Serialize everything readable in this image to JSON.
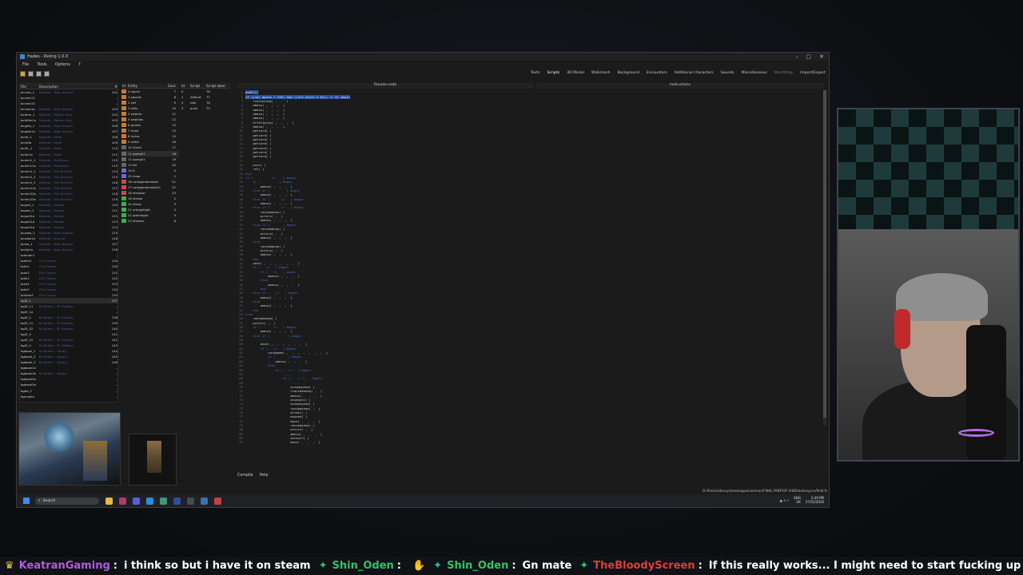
{
  "window": {
    "title": "Hades - Deling 1.0.0",
    "controls": [
      "–",
      "▢",
      "✕"
    ]
  },
  "menu": [
    "File",
    "Tools",
    "Options",
    "?"
  ],
  "tabs": [
    "Texts",
    "Scripts",
    "3D Model",
    "Walkmesh",
    "Background",
    "Encounters",
    "Additional characters",
    "Sounds",
    "Miscellaneous",
    "Worldmap",
    "Import/Export"
  ],
  "active_tab": "Scripts",
  "file_list": {
    "headers": [
      "File",
      "Description",
      "#"
    ],
    "rows": [
      [
        "bccent_1",
        "Balamb - Town Square",
        "102"
      ],
      [
        "bccent12",
        "",
        "–"
      ],
      [
        "bccent13",
        "",
        "–"
      ],
      [
        "bccent1a",
        "Balamb - Town Square",
        "103"
      ],
      [
        "bcform_1",
        "Balamb - Station Yard",
        "104"
      ],
      [
        "bchtlfm1a",
        "Balamb - Station Yard",
        "105"
      ],
      [
        "bcgate_1",
        "Balamb - Town Square",
        "106"
      ],
      [
        "bcgate1a",
        "Balamb - Town Square",
        "107"
      ],
      [
        "bchtl_1",
        "Balamb - Hotel",
        "108"
      ],
      [
        "bchtlfa",
        "Balamb - Hotel",
        "109"
      ],
      [
        "bchtr_1",
        "Balamb - Hotel",
        "110"
      ],
      [
        "bchtr1a",
        "Balamb - Hotel",
        "111"
      ],
      [
        "bcmin1_1",
        "Balamb - Residence",
        "112"
      ],
      [
        "bcmin11a",
        "Balamb - Residence",
        "113"
      ],
      [
        "bcmin2_1",
        "Balamb - The Dincht's",
        "114"
      ],
      [
        "bcmin2_2",
        "Balamb - The Dincht's",
        "115"
      ],
      [
        "bcmin2_3",
        "Balamb - The Dincht's",
        "116"
      ],
      [
        "bcmin21a",
        "Balamb - The Dincht's",
        "117"
      ],
      [
        "bcmin22a",
        "Balamb - The Dincht's",
        "118"
      ],
      [
        "bcmin23a",
        "Balamb - The Dincht's",
        "119"
      ],
      [
        "bcport_1",
        "Balamb - Harbor",
        "120"
      ],
      [
        "bcport_2",
        "Balamb - Harbor",
        "121"
      ],
      [
        "bcport1a",
        "Balamb - Harbor",
        "122"
      ],
      [
        "bcport1b",
        "Balamb - Harbor",
        "123"
      ],
      [
        "bcport2a",
        "Balamb - Harbor",
        "124"
      ],
      [
        "bcsaka_1",
        "Balamb - Town Square",
        "125"
      ],
      [
        "bcsaka1a",
        "Balamb - Alcauld",
        "126"
      ],
      [
        "bcsta_1",
        "Balamb - Town Square",
        "127"
      ],
      [
        "bcsta1a",
        "Balamb - Town Square",
        "128"
      ],
      [
        "bdenter1",
        "",
        "–"
      ],
      [
        "bdifnt1",
        "Fire Cavern",
        "129"
      ],
      [
        "bdin1",
        "Fire Cavern",
        "130"
      ],
      [
        "bdin2",
        "Fire Cavern",
        "131"
      ],
      [
        "bdin3",
        "Fire Cavern",
        "132"
      ],
      [
        "bdin4",
        "Fire Cavern",
        "133"
      ],
      [
        "bdin5",
        "Fire Cavern",
        "134"
      ],
      [
        "bdview1",
        "Fire Cavern",
        "135"
      ],
      [
        "bg2f_1",
        "",
        "137"
      ],
      [
        "bg2f_11",
        "B-Garden - 2F Hallway",
        "–"
      ],
      [
        "bg2f_1a",
        "",
        "–"
      ],
      [
        "bg2f_2",
        "B-Garden - 2F Hallway",
        "138"
      ],
      [
        "bg2f_21",
        "B-Garden - 2F Hallway",
        "139"
      ],
      [
        "bg2f_22",
        "B-Garden - 2F Hallway",
        "140"
      ],
      [
        "bg2f_3",
        "",
        "141"
      ],
      [
        "bg2f_31",
        "B-Garden - 2F Hallway",
        "142"
      ],
      [
        "bg2f_4",
        "B-Garden - 2F Hallway",
        "143"
      ],
      [
        "bgbook_1",
        "B-Garden - Library",
        "144"
      ],
      [
        "bgbook_2",
        "B-Garden - Library",
        "145"
      ],
      [
        "bgbook_3",
        "B-Garden - Library",
        "146"
      ],
      [
        "bgbook1a",
        "",
        "–"
      ],
      [
        "bgbook1b",
        "B-Garden - Library",
        "–"
      ],
      [
        "bgbook2a",
        "",
        "–"
      ],
      [
        "bgbook3a",
        "",
        "–"
      ],
      [
        "bgbtl_1",
        "",
        "–"
      ],
      [
        "bgcrash1",
        "",
        "–"
      ]
    ],
    "selected_index": 37
  },
  "entity_list": {
    "headers": [
      "Id",
      "Entity",
      "Exec"
    ],
    "rows": [
      [
        "0",
        "squall",
        "7"
      ],
      [
        "1",
        "squalls",
        "8"
      ],
      [
        "2",
        "zell",
        "9"
      ],
      [
        "3",
        "zells",
        "10"
      ],
      [
        "4",
        "selphia",
        "11"
      ],
      [
        "5",
        "selphias",
        "12"
      ],
      [
        "6",
        "quistis",
        "13"
      ],
      [
        "7",
        "rinoa",
        "14"
      ],
      [
        "8",
        "irvine",
        "15"
      ],
      [
        "9",
        "seifer",
        "16"
      ],
      [
        "10",
        "check",
        "17"
      ],
      [
        "11",
        "pomp01",
        "18"
      ],
      [
        "12",
        "pomp02",
        "19"
      ],
      [
        "13",
        "dic",
        "20"
      ],
      [
        "14",
        "tl",
        "0"
      ],
      [
        "15",
        "lmap",
        "1"
      ],
      [
        "16",
        "cardgamemaster",
        "21"
      ],
      [
        "17",
        "cardgamemaster2",
        "22"
      ],
      [
        "18",
        "elevator",
        "23"
      ],
      [
        "19",
        "elelow",
        "2"
      ],
      [
        "20",
        "eleup",
        "3"
      ],
      [
        "21",
        "orangelight",
        "4"
      ],
      [
        "22",
        "greenlight",
        "5"
      ],
      [
        "23",
        "eledoor",
        "6"
      ]
    ],
    "selected_index": 11
  },
  "script_list": {
    "headers": [
      "Id",
      "Script",
      "Script label"
    ],
    "rows": [
      [
        "0",
        "",
        "76"
      ],
      [
        "1",
        "default",
        "77"
      ],
      [
        "2",
        "talk",
        "78"
      ],
      [
        "3",
        "push",
        "79"
      ]
    ]
  },
  "editor": {
    "pseudo_code_label": "Pseudo-code",
    "instructions_label": "Instructions",
    "lines": [
      {
        "n": "1",
        "t": "endfl()",
        "k": "hl"
      },
      {
        "n": "2",
        "t": "if ((var_mwseo < 216) and ((u74_ubyte & 64)) == 0) begin",
        "k": "hl"
      },
      {
        "n": "3",
        "t": "    rcanimloop( ,  ,  )",
        "k": ""
      },
      {
        "n": "4",
        "t": "    amesw( ,  ,  ,  )",
        "k": ""
      },
      {
        "n": "5",
        "t": "    amesw( ,  ,  ,  )",
        "k": ""
      },
      {
        "n": "6",
        "t": "    amesw( ,  ,  ,  )",
        "k": ""
      },
      {
        "n": "7",
        "t": "    amesw( ,  ,  ,  )",
        "k": ""
      },
      {
        "n": "8",
        "t": "    effectplay( ,  ,  ,  )",
        "k": ""
      },
      {
        "n": "9",
        "t": "    amesw( ,  ,  ,  )",
        "k": ""
      },
      {
        "n": "10",
        "t": "    getcard( )",
        "k": ""
      },
      {
        "n": "11",
        "t": "    getcard( )",
        "k": ""
      },
      {
        "n": "12",
        "t": "    getcard( )",
        "k": ""
      },
      {
        "n": "13",
        "t": "    getcard( )",
        "k": ""
      },
      {
        "n": "14",
        "t": "    getcard( )",
        "k": ""
      },
      {
        "n": "15",
        "t": "    getcard( )",
        "k": ""
      },
      {
        "n": "16",
        "t": "    getcard( )",
        "k": ""
      },
      {
        "n": "17",
        "t": "    ----",
        "k": "kw"
      },
      {
        "n": "18",
        "t": "    winc( )",
        "k": ""
      },
      {
        "n": "19",
        "t": "    ret( )",
        "k": ""
      },
      {
        "n": "20",
        "t": "end",
        "k": "kw"
      },
      {
        "n": "21",
        "t": "if (          ==    ) begin",
        "k": "kw"
      },
      {
        "n": "22",
        "t": "    if (          ) begin",
        "k": "kw"
      },
      {
        "n": "23",
        "t": "        amesw( ,  ,  ,  )",
        "k": ""
      },
      {
        "n": "24",
        "t": "    else if (         ) begin",
        "k": "kw"
      },
      {
        "n": "25",
        "t": "        amesw( ,  ,  ,  )",
        "k": ""
      },
      {
        "n": "26",
        "t": "    else if (      ==   ) begin",
        "k": "kw"
      },
      {
        "n": "27",
        "t": "        amesw( ,  ,  ,  )",
        "k": ""
      },
      {
        "n": "28",
        "t": "    else if (      ==   ) begin",
        "k": "kw"
      },
      {
        "n": "29",
        "t": "        ranimakeep( )",
        "k": ""
      },
      {
        "n": "30",
        "t": "        pcturn( ,  )",
        "k": ""
      },
      {
        "n": "31",
        "t": "        amesw( ,  ,  ,  )",
        "k": ""
      },
      {
        "n": "32",
        "t": "    else if (       ) begin",
        "k": "kw"
      },
      {
        "n": "33",
        "t": "        ranimakeep( )",
        "k": ""
      },
      {
        "n": "34",
        "t": "        pcturn( ,  )",
        "k": ""
      },
      {
        "n": "35",
        "t": "        amesw( ,  ,  ,  )",
        "k": ""
      },
      {
        "n": "36",
        "t": "    else",
        "k": "kw"
      },
      {
        "n": "37",
        "t": "        ranimakeep( )",
        "k": ""
      },
      {
        "n": "38",
        "t": "        pcturn( ,  )",
        "k": ""
      },
      {
        "n": "39",
        "t": "        amesw( ,  ,  ,  )",
        "k": ""
      },
      {
        "n": "40",
        "t": "    end",
        "k": "kw"
      },
      {
        "n": "41",
        "t": "    aask( ,  ,  ,  ,  ,  ,  )",
        "k": ""
      },
      {
        "n": "42",
        "t": "    if (   ==   ) begin",
        "k": "kw"
      },
      {
        "n": "43",
        "t": "        if (   ==   ) begin",
        "k": "kw"
      },
      {
        "n": "44",
        "t": "            amesw( ,  ,  ,  )",
        "k": ""
      },
      {
        "n": "45",
        "t": "        else",
        "k": "kw"
      },
      {
        "n": "46",
        "t": "            amesw( ,  ,  ,  )",
        "k": ""
      },
      {
        "n": "47",
        "t": "        end",
        "k": "kw"
      },
      {
        "n": "48",
        "t": "    else if (   ==   ) begin",
        "k": "kw"
      },
      {
        "n": "49",
        "t": "        amesw( ,  ,  ,  )",
        "k": ""
      },
      {
        "n": "50",
        "t": "    else",
        "k": "kw"
      },
      {
        "n": "51",
        "t": "        amesw( ,  ,  ,  )",
        "k": ""
      },
      {
        "n": "52",
        "t": "    end",
        "k": "kw"
      },
      {
        "n": "53",
        "t": "else",
        "k": "kw"
      },
      {
        "n": "54",
        "t": "    ranimakeep( )",
        "k": ""
      },
      {
        "n": "55",
        "t": "    pcturn( ,  )",
        "k": ""
      },
      {
        "n": "56",
        "t": "    if (       ==   ) begin",
        "k": "kw"
      },
      {
        "n": "57",
        "t": "        amesw( ,  ,  ,  )",
        "k": ""
      },
      {
        "n": "58",
        "t": "    else if (          ) begin",
        "k": "kw"
      },
      {
        "n": "59",
        "t": "        ----",
        "k": "kw"
      },
      {
        "n": "60",
        "t": "        aask( ,  ,  ,  ,  ,  ,  )",
        "k": ""
      },
      {
        "n": "61",
        "t": "        if (   ==   ) begin",
        "k": "kw"
      },
      {
        "n": "62",
        "t": "            cardgame( ,  ,  ,  ,  ,  ,  ,  )",
        "k": ""
      },
      {
        "n": "63",
        "t": "            if (       ) begin",
        "k": "kw"
      },
      {
        "n": "64",
        "t": "                amesw( ,  ,  ,  )",
        "k": ""
      },
      {
        "n": "65",
        "t": "            else",
        "k": "kw"
      },
      {
        "n": "66",
        "t": "                if (   ==   ) begin",
        "k": "kw"
      },
      {
        "n": "67",
        "t": "                    ----",
        "k": "kw"
      },
      {
        "n": "68",
        "t": "                    if (    ) ==    begin",
        "k": "kw"
      },
      {
        "n": "69",
        "t": "                        ----",
        "k": "kw"
      },
      {
        "n": "70",
        "t": "                        animaspeed( )",
        "k": ""
      },
      {
        "n": "71",
        "t": "                        rcanimakeep( ,  )",
        "k": ""
      },
      {
        "n": "72",
        "t": "                        amesw( ,  ,  ,  )",
        "k": ""
      },
      {
        "n": "73",
        "t": "                        animsync( )",
        "k": ""
      },
      {
        "n": "74",
        "t": "                        animaspeed( )",
        "k": ""
      },
      {
        "n": "75",
        "t": "                        ranimakeep( ,  )",
        "k": ""
      },
      {
        "n": "76",
        "t": "                        mlimit( )",
        "k": ""
      },
      {
        "n": "77",
        "t": "                        mspeed( )",
        "k": ""
      },
      {
        "n": "78",
        "t": "                        move( ,  ,  ,  )",
        "k": ""
      },
      {
        "n": "79",
        "t": "                        ranimakeep( )",
        "k": ""
      },
      {
        "n": "80",
        "t": "                        pcturn( ,  )",
        "k": ""
      },
      {
        "n": "81",
        "t": "                        amesw( ,  ,  ,  )",
        "k": ""
      },
      {
        "n": "82",
        "t": "                        talkoff( )",
        "k": ""
      },
      {
        "n": "83",
        "t": "                        move( ,  ,  ,  )",
        "k": ""
      }
    ]
  },
  "bottom_buttons": [
    "Compile",
    "Help"
  ],
  "status_path": "D:/SteamLibrary/steamapps/common/FINAL FANTASY VIII/Data/lang-en/field.fs",
  "taskbar": {
    "search_placeholder": "Search",
    "tray_lang": "ENG",
    "tray_region": "UK",
    "time": "2:49 PM",
    "date": "27/03/2026"
  },
  "chat_ticker": [
    {
      "user": "KeatranGaming",
      "color": "#b15be3",
      "message": "i think so but i have it on steam"
    },
    {
      "user": "Shin_Oden",
      "color": "#2fc26a",
      "message": ""
    },
    {
      "user": "Shin_Oden",
      "color": "#2fc26a",
      "message": "Gn mate"
    },
    {
      "user": "TheBloodyScreen",
      "color": "#e23b3b",
      "message": "If this really works... I might need to start fucking up FFVIII"
    }
  ]
}
